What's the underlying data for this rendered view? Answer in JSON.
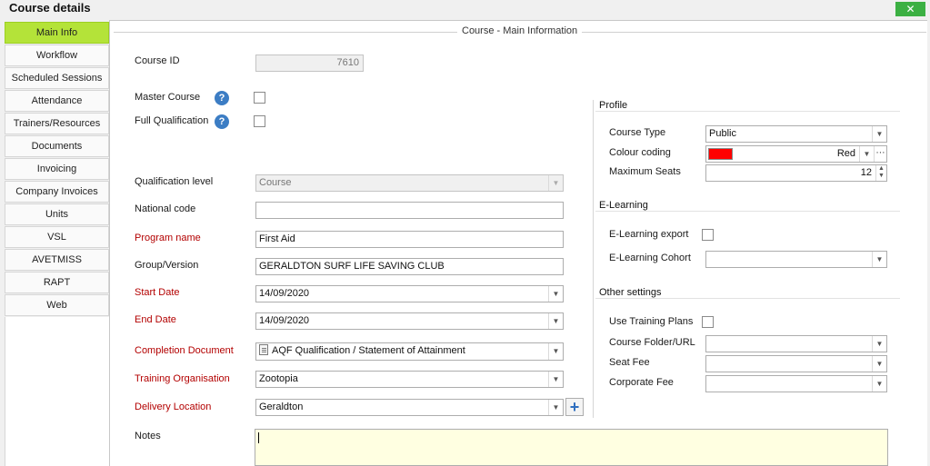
{
  "window": {
    "title": "Course details",
    "close_icon": "✕"
  },
  "tabs": [
    {
      "label": "Main Info",
      "active": true
    },
    {
      "label": "Workflow"
    },
    {
      "label": "Scheduled Sessions"
    },
    {
      "label": "Attendance"
    },
    {
      "label": "Trainers/Resources"
    },
    {
      "label": "Documents"
    },
    {
      "label": "Invoicing"
    },
    {
      "label": "Company Invoices"
    },
    {
      "label": "Units"
    },
    {
      "label": "VSL"
    },
    {
      "label": "AVETMISS"
    },
    {
      "label": "RAPT"
    },
    {
      "label": "Web"
    }
  ],
  "main": {
    "group_title": "Course - Main Information",
    "course_id_label": "Course ID",
    "course_id_value": "7610",
    "master_course_label": "Master Course",
    "full_qualification_label": "Full Qualification",
    "qualification_level_label": "Qualification level",
    "qualification_level_value": "Course",
    "national_code_label": "National code",
    "national_code_value": "",
    "program_name_label": "Program name",
    "program_name_value": "First Aid",
    "group_version_label": "Group/Version",
    "group_version_value": "GERALDTON SURF LIFE SAVING CLUB",
    "start_date_label": "Start Date",
    "start_date_value": "14/09/2020",
    "end_date_label": "End Date",
    "end_date_value": "14/09/2020",
    "completion_document_label": "Completion Document",
    "completion_document_value": "AQF Qualification / Statement of Attainment",
    "training_organisation_label": "Training Organisation",
    "training_organisation_value": "Zootopia",
    "delivery_location_label": "Delivery Location",
    "delivery_location_value": "Geraldton",
    "notes_label": "Notes",
    "notes_value": "",
    "help_glyph": "?",
    "plus_glyph": "+"
  },
  "profile": {
    "title": "Profile",
    "course_type_label": "Course Type",
    "course_type_value": "Public",
    "colour_coding_label": "Colour coding",
    "colour_coding_value": "Red",
    "colour_coding_hex": "#ff0000",
    "maximum_seats_label": "Maximum Seats",
    "maximum_seats_value": "12"
  },
  "elearning": {
    "title": "E-Learning",
    "export_label": "E-Learning export",
    "cohort_label": "E-Learning Cohort",
    "cohort_value": ""
  },
  "other_settings": {
    "title": "Other settings",
    "use_training_plans_label": "Use Training Plans",
    "course_folder_label": "Course Folder/URL",
    "course_folder_value": "",
    "seat_fee_label": "Seat Fee",
    "seat_fee_value": "",
    "corporate_fee_label": "Corporate Fee",
    "corporate_fee_value": ""
  },
  "colors": {
    "active_tab": "#b4e339",
    "required_label": "#b30000",
    "close_button": "#3cb043",
    "notes_background": "#ffffe1"
  }
}
